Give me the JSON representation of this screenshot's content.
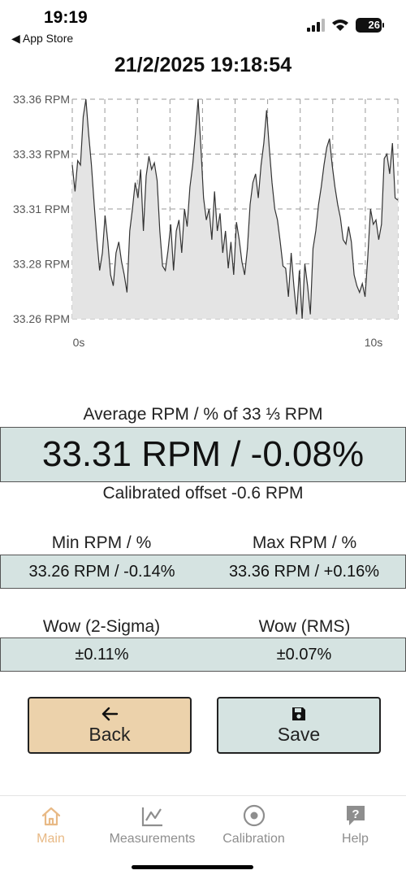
{
  "status_bar": {
    "time": "19:19",
    "back_app": "◀ App Store",
    "battery": "26"
  },
  "header": {
    "datetime": "21/2/2025 19:18:54"
  },
  "chart_data": {
    "type": "area",
    "y_tick_labels": [
      "33.36 RPM",
      "33.33 RPM",
      "33.31 RPM",
      "33.28 RPM",
      "33.26 RPM"
    ],
    "y_ticks": [
      33.36,
      33.335,
      33.31,
      33.285,
      33.26
    ],
    "x_tick_labels": [
      "0s",
      "10s"
    ],
    "ylim": [
      33.26,
      33.36
    ],
    "xlim": [
      0,
      10
    ],
    "grid": true,
    "fill_color": "#e4e4e4",
    "line_color": "#333333",
    "y": [
      33.33,
      33.318,
      33.332,
      33.33,
      33.352,
      33.36,
      33.344,
      33.33,
      33.312,
      33.296,
      33.282,
      33.29,
      33.307,
      33.295,
      33.28,
      33.275,
      33.29,
      33.295,
      33.286,
      33.28,
      33.272,
      33.3,
      33.31,
      33.322,
      33.315,
      33.328,
      33.3,
      33.325,
      33.334,
      33.328,
      33.331,
      33.323,
      33.3,
      33.284,
      33.282,
      33.291,
      33.303,
      33.282,
      33.3,
      33.305,
      33.29,
      33.31,
      33.302,
      33.32,
      33.33,
      33.344,
      33.36,
      33.338,
      33.315,
      33.305,
      33.31,
      33.296,
      33.318,
      33.3,
      33.308,
      33.29,
      33.3,
      33.283,
      33.295,
      33.28,
      33.304,
      33.296,
      33.286,
      33.28,
      33.292,
      33.312,
      33.322,
      33.326,
      33.315,
      33.33,
      33.34,
      33.355,
      33.338,
      33.322,
      33.31,
      33.305,
      33.295,
      33.284,
      33.283,
      33.27,
      33.29,
      33.275,
      33.262,
      33.282,
      33.26,
      33.285,
      33.275,
      33.262,
      33.292,
      33.3,
      33.312,
      33.32,
      33.33,
      33.338,
      33.342,
      33.33,
      33.32,
      33.312,
      33.306,
      33.296,
      33.294,
      33.302,
      33.295,
      33.28,
      33.275,
      33.272,
      33.276,
      33.27,
      33.288,
      33.31,
      33.303,
      33.305,
      33.296,
      33.303,
      33.333,
      33.335,
      33.326,
      33.34,
      33.315,
      33.314
    ]
  },
  "summary": {
    "avg_label": "Average RPM / % of 33 ⅓ RPM",
    "avg_value": "33.31 RPM / -0.08%",
    "calibrated_offset": "Calibrated offset  -0.6 RPM",
    "min_label": "Min RPM / %",
    "max_label": "Max RPM / %",
    "min_value": "33.26 RPM / -0.14%",
    "max_value": "33.36 RPM / +0.16%",
    "wow2_label": "Wow (2-Sigma)",
    "wowrms_label": "Wow (RMS)",
    "wow2_value": "±0.11%",
    "wowrms_value": "±0.07%"
  },
  "buttons": {
    "back": "Back",
    "save": "Save"
  },
  "tabs": [
    {
      "label": "Main",
      "icon": "home-icon",
      "active": true
    },
    {
      "label": "Measurements",
      "icon": "line-chart-icon",
      "active": false
    },
    {
      "label": "Calibration",
      "icon": "target-icon",
      "active": false
    },
    {
      "label": "Help",
      "icon": "help-icon",
      "active": false
    }
  ],
  "colors": {
    "panel": "#d5e3e1",
    "back_button": "#ecd2ab",
    "active_tab": "#e8b985",
    "inactive_tab": "#8e8e8e"
  }
}
